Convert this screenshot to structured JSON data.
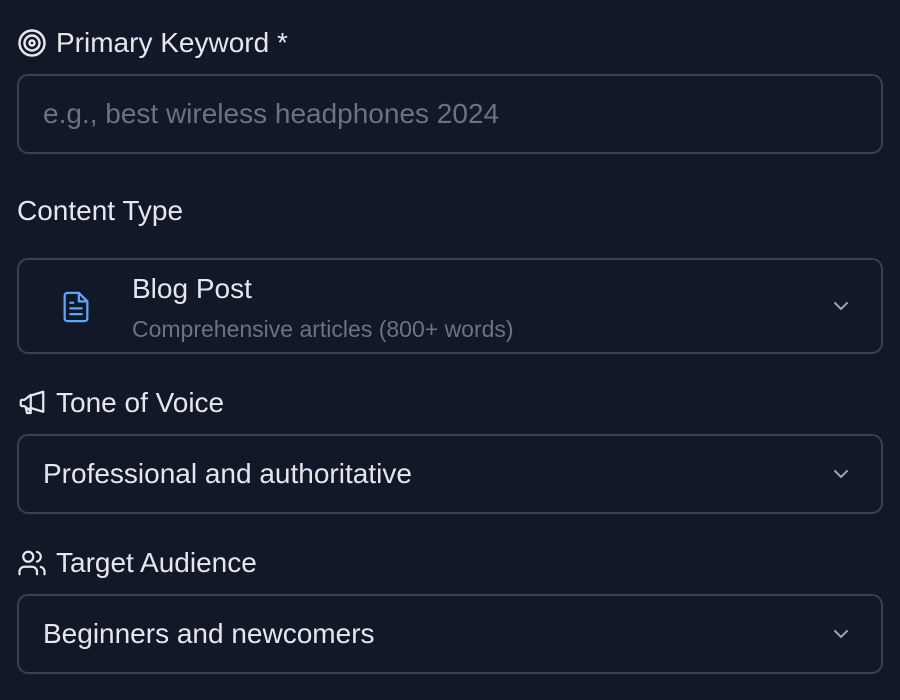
{
  "primary_keyword": {
    "label": "Primary Keyword *",
    "placeholder": "e.g., best wireless headphones 2024",
    "value": "",
    "icon": "target-icon"
  },
  "content_type": {
    "label": "Content Type",
    "selected_title": "Blog Post",
    "selected_description": "Comprehensive articles (800+ words)",
    "icon": "document-icon",
    "icon_color": "#60a5fa"
  },
  "tone_of_voice": {
    "label": "Tone of Voice",
    "selected": "Professional and authoritative",
    "icon": "megaphone-icon"
  },
  "target_audience": {
    "label": "Target Audience",
    "selected": "Beginners and newcomers",
    "icon": "users-icon"
  },
  "colors": {
    "background": "#111827",
    "border": "#374151",
    "text": "#e5e7eb",
    "muted": "#6b7280",
    "accent": "#60a5fa"
  }
}
